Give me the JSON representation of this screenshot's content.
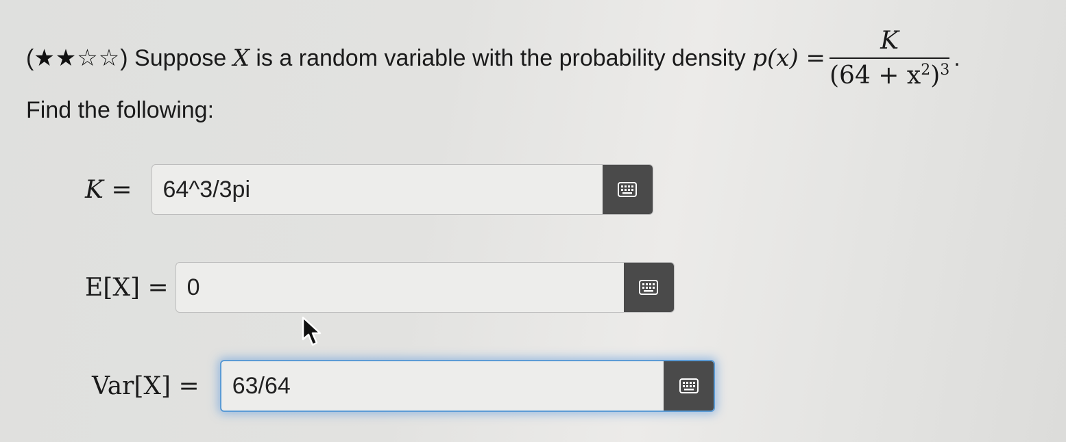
{
  "question": {
    "stars_filled": "★★",
    "stars_empty": "☆☆",
    "text": "Suppose",
    "var": "X",
    "text2": "is a random variable with the probability density",
    "lhs": "p(x) =",
    "numerator": "K",
    "denominator_base": "(64 + x",
    "denominator_inner_exp": "2",
    "denominator_close": ")",
    "denominator_exp": "3",
    "end": "."
  },
  "instruction": "Find the following:",
  "fields": [
    {
      "label": "K =",
      "value": "64^3/3pi"
    },
    {
      "label": "E[X] =",
      "value": "0"
    },
    {
      "label": "Var[X] =",
      "value": "63/64"
    }
  ],
  "icons": {
    "keyboard": "keyboard-icon",
    "cursor": "mouse-pointer-icon"
  }
}
